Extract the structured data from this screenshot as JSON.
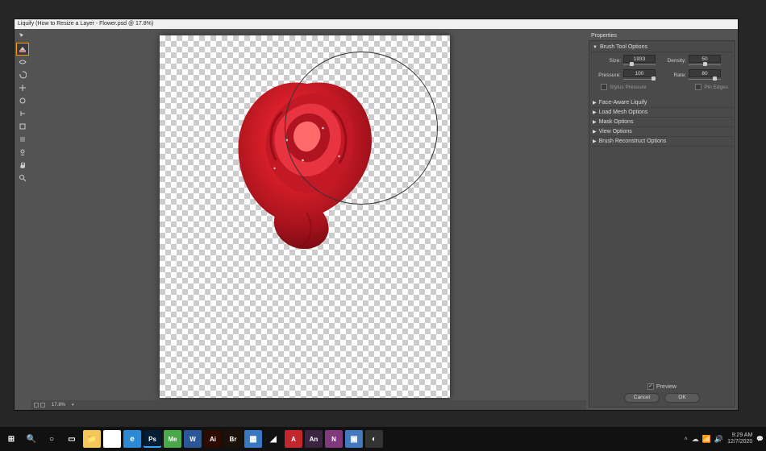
{
  "window": {
    "title": "Liquify (How to Resize a Layer - Flower.psd @ 17.8%)"
  },
  "tools": [
    {
      "name": "forward-warp",
      "selected": false
    },
    {
      "name": "reconstruct",
      "selected": true
    },
    {
      "name": "smooth",
      "selected": false
    },
    {
      "name": "twirl",
      "selected": false
    },
    {
      "name": "pucker",
      "selected": false
    },
    {
      "name": "bloat",
      "selected": false
    },
    {
      "name": "push-left",
      "selected": false
    },
    {
      "name": "freeze-mask",
      "selected": false
    },
    {
      "name": "thaw-mask",
      "selected": false
    },
    {
      "name": "face",
      "selected": false
    },
    {
      "name": "hand",
      "selected": false
    },
    {
      "name": "zoom",
      "selected": false
    }
  ],
  "status": {
    "zoom": "17.8%"
  },
  "panel": {
    "title": "Properties",
    "sections": {
      "brush": {
        "label": "Brush Tool Options",
        "size_label": "Size:",
        "size": "1933",
        "density_label": "Density:",
        "density": "50",
        "pressure_label": "Pressure:",
        "pressure": "100",
        "rate_label": "Rate:",
        "rate": "80",
        "stylus_label": "Stylus Pressure",
        "pin_label": "Pin Edges"
      },
      "face": {
        "label": "Face-Aware Liquify"
      },
      "mesh": {
        "label": "Load Mesh Options"
      },
      "mask": {
        "label": "Mask Options"
      },
      "view": {
        "label": "View Options"
      },
      "reconstruct": {
        "label": "Brush Reconstruct Options"
      }
    },
    "preview_label": "Preview",
    "cancel": "Cancel",
    "ok": "OK"
  },
  "taskbar": {
    "time": "9:29 AM",
    "date": "12/7/2020",
    "apps": [
      {
        "name": "start",
        "color": "#111",
        "text": "⊞"
      },
      {
        "name": "search",
        "color": "#111",
        "text": "🔍"
      },
      {
        "name": "cortana",
        "color": "#111",
        "text": "○"
      },
      {
        "name": "taskview",
        "color": "#111",
        "text": "▭"
      },
      {
        "name": "explorer",
        "color": "#f5c658",
        "text": "📁"
      },
      {
        "name": "chrome",
        "color": "#fff",
        "text": "◉"
      },
      {
        "name": "edge",
        "color": "#2b8ad6",
        "text": "e"
      },
      {
        "name": "photoshop",
        "color": "#001d34",
        "text": "Ps"
      },
      {
        "name": "mediaencoder",
        "color": "#4aa84a",
        "text": "Me"
      },
      {
        "name": "word",
        "color": "#2b5797",
        "text": "W"
      },
      {
        "name": "illustrator",
        "color": "#2d0a00",
        "text": "Ai"
      },
      {
        "name": "bridge",
        "color": "#1a1208",
        "text": "Br"
      },
      {
        "name": "calc",
        "color": "#3a77c2",
        "text": "▦"
      },
      {
        "name": "steam",
        "color": "#111",
        "text": "◢"
      },
      {
        "name": "acrobat",
        "color": "#c1272d",
        "text": "A"
      },
      {
        "name": "animate",
        "color": "#3b2342",
        "text": "An"
      },
      {
        "name": "onenote",
        "color": "#80397b",
        "text": "N"
      },
      {
        "name": "app1",
        "color": "#4178be",
        "text": "▣"
      },
      {
        "name": "app2",
        "color": "#333",
        "text": "◐"
      }
    ]
  }
}
